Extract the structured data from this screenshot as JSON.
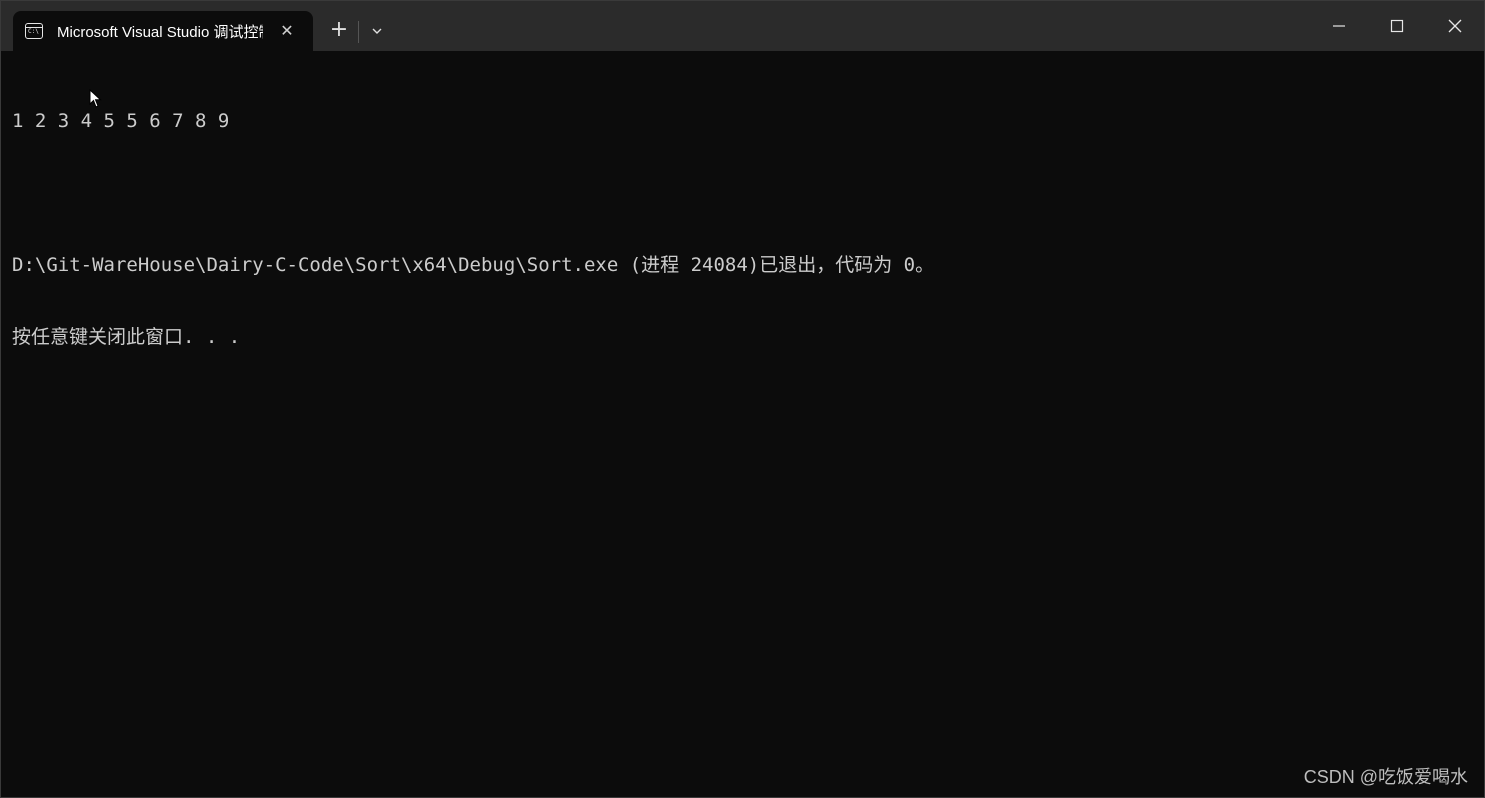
{
  "window": {
    "tab_title": "Microsoft Visual Studio 调试控制台",
    "tab_close_symbol": "✕",
    "new_tab_symbol": "+"
  },
  "terminal": {
    "lines": [
      "1 2 3 4 5 5 6 7 8 9",
      "",
      "D:\\Git-WareHouse\\Dairy-C-Code\\Sort\\x64\\Debug\\Sort.exe (进程 24084)已退出，代码为 0。",
      "按任意键关闭此窗口. . ."
    ]
  },
  "watermark": "CSDN @吃饭爱喝水",
  "icons": {
    "tab": "console-icon",
    "dropdown": "chevron-down-icon",
    "minimize": "minimize-icon",
    "maximize": "maximize-icon",
    "close": "close-icon",
    "pointer": "mouse-pointer-icon"
  },
  "colors": {
    "terminal_bg": "#0c0c0c",
    "titlebar_bg": "#2b2b2b",
    "text": "#cccccc"
  }
}
